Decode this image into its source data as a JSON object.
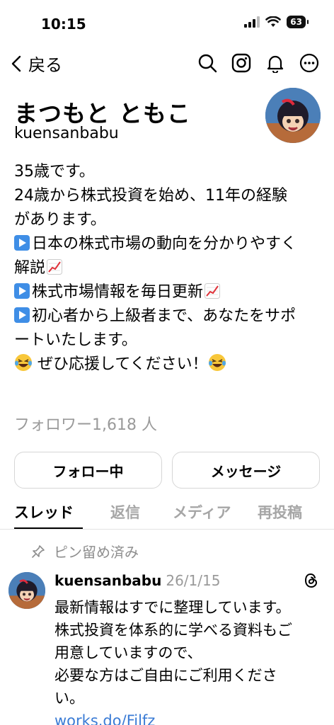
{
  "status_bar": {
    "time": "10:15",
    "battery": "63"
  },
  "nav": {
    "back_label": "戻る",
    "icons": [
      "search-icon",
      "instagram-icon",
      "bell-icon",
      "more-icon"
    ]
  },
  "profile": {
    "display_name": "まつもと ともこ",
    "username": "kuensanbabu",
    "bio_lines": [
      "35歳です。",
      "24歳から株式投資を始め、11年の経験",
      "があります。",
      "日本の株式市場の動向を分かりやすく",
      "解説",
      "株式市場情報を毎日更新",
      "初心者から上級者まで、あなたをサポ",
      "ートいたします。",
      " ぜひ応援してください！"
    ],
    "followers": "フォロワー1,618 人"
  },
  "actions": {
    "follow_label": "フォロー中",
    "message_label": "メッセージ"
  },
  "tabs": [
    "スレッド",
    "返信",
    "メディア",
    "再投稿"
  ],
  "pinned": {
    "label": "ピン留め済み"
  },
  "post": {
    "username": "kuensanbabu",
    "date": "26/1/15",
    "body_lines": [
      "最新情報はすでに整理しています。",
      "株式投資を体系的に学べる資料もご",
      "用意していますので、",
      "必要な方はご自由にご利用くださ",
      "い。"
    ],
    "link": "works.do/Filfz"
  },
  "colors": {
    "accent": "#3f8ee6",
    "link": "#3a7bd5",
    "muted": "#9a9a9a",
    "chart_red": "#e0323a"
  }
}
